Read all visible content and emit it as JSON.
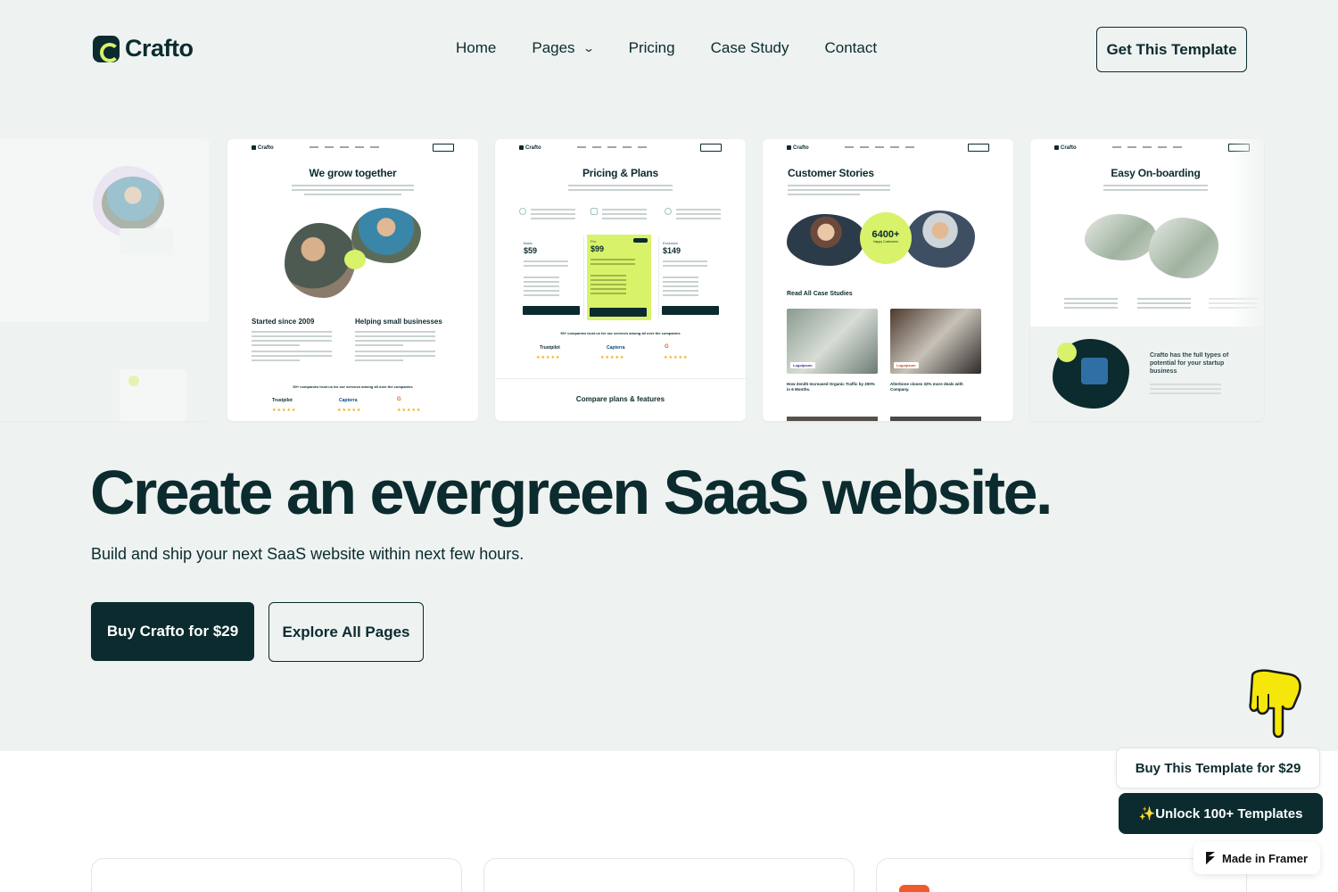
{
  "brand": {
    "name": "Crafto"
  },
  "nav": {
    "links": [
      "Home",
      "Pages",
      "Pricing",
      "Case Study",
      "Contact"
    ],
    "cta": "Get This Template"
  },
  "previews": [
    {
      "title": "We grow together",
      "col1": "Started since 2009",
      "col2": "Helping small businesses",
      "trust": "50+ companies trust us for our services among all over the companies",
      "logos": [
        "Trustpilot",
        "Capterra",
        "G"
      ]
    },
    {
      "title": "Pricing & Plans",
      "prices": [
        "$59",
        "$99",
        "$149"
      ],
      "trust": "50+ companies trust us for our services among all over the companies",
      "logos": [
        "Trustpilot",
        "Capterra",
        "G"
      ],
      "footer": "Compare plans & features"
    },
    {
      "title": "Customer Stories",
      "stat": "6400+",
      "stat_label": "Happy Customers",
      "section": "Read All Case Studies",
      "cases": [
        "How Zenith Increased Organic Traffic by 200% in 6 Months.",
        "Alterbone closes 32% more deals with Company."
      ],
      "badge": "Logoipsum"
    },
    {
      "title": "Easy On-boarding",
      "side_text": "Crafto has the full types of potential for your startup business"
    }
  ],
  "hero": {
    "headline": "Create an evergreen SaaS website.",
    "subline": "Build and ship your next SaaS website within next few hours.",
    "primary_button": "Buy Crafto for $29",
    "secondary_button": "Explore All Pages"
  },
  "promo": {
    "buy": "Buy This Template for $29",
    "unlock": "✨Unlock 100+ Templates",
    "framer": "Made in Framer"
  },
  "colors": {
    "dark": "#0b2b2e",
    "lime": "#d8f26a",
    "hero_bg": "#eef2f1",
    "accent_orange": "#ef5a2f"
  }
}
